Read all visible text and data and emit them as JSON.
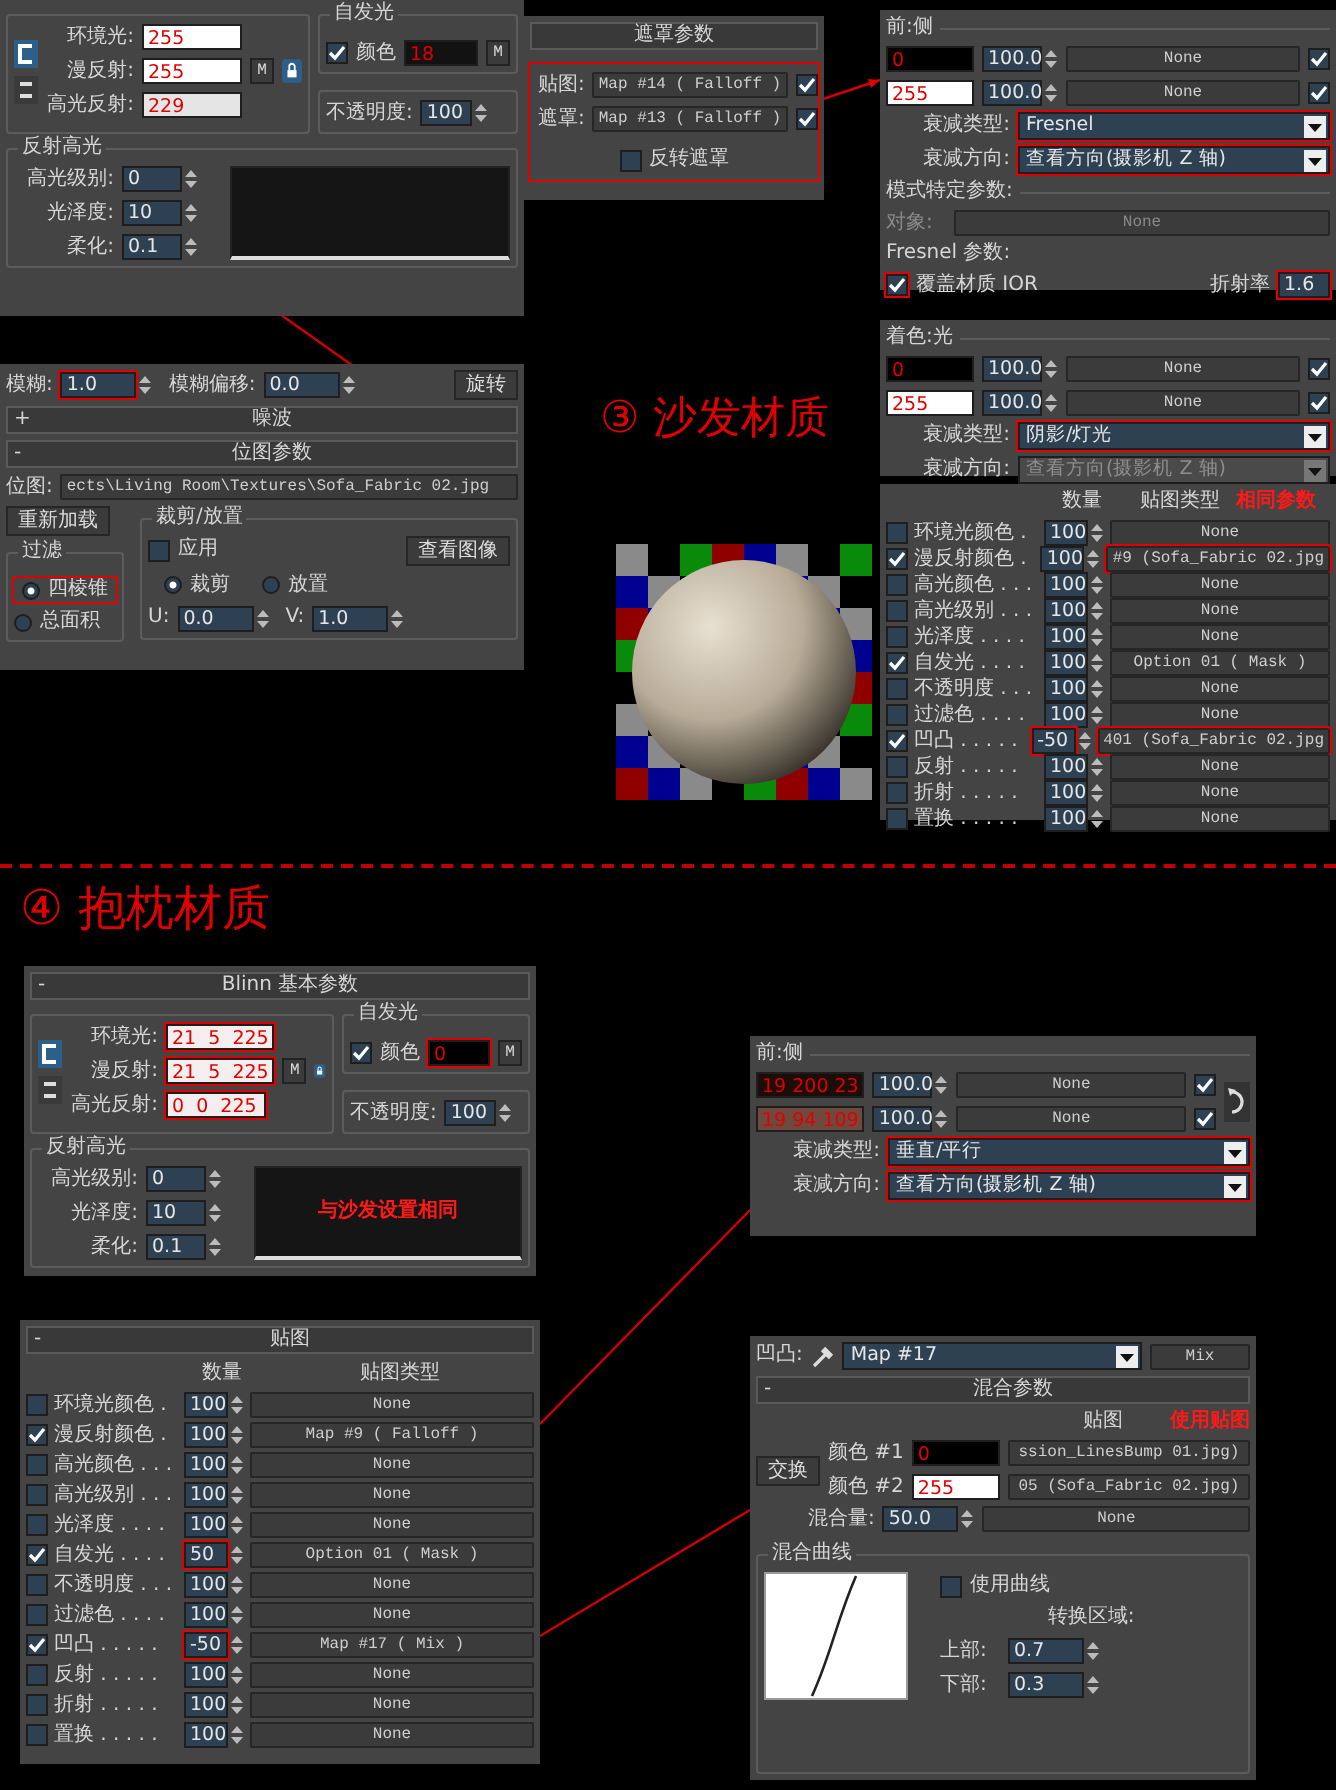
{
  "panels": [
    {
      "kind": "blinn",
      "colors": [
        {
          "label": "环境光:",
          "value": "255",
          "color": "#ffffff"
        },
        {
          "label": "漫反射:",
          "value": "255",
          "color": "#ffffff",
          "map_button": "M"
        },
        {
          "label": "高光反射:",
          "value": "229",
          "color": "#e5e5e5"
        }
      ],
      "self_illum": {
        "title": "自发光",
        "checked": true,
        "label": "颜色",
        "value": "18",
        "color": "#121212",
        "map_button": "M"
      },
      "opacity": {
        "label": "不透明度:",
        "value": "100"
      },
      "specular": {
        "title": "反射高光",
        "fields": [
          {
            "label": "高光级别:",
            "value": "0"
          },
          {
            "label": "光泽度:",
            "value": "10"
          },
          {
            "label": "柔化:",
            "value": "0.1"
          }
        ]
      }
    },
    {
      "kind": "mask",
      "title": {
        "text": "遮罩参数"
      },
      "highlighted": true,
      "rows": [
        {
          "label": "贴图:",
          "map": "Map #14  ( Falloff )",
          "checked": true
        },
        {
          "label": "遮罩:",
          "map": "Map #13  ( Falloff )",
          "checked": true
        }
      ],
      "invert": {
        "label": "反转遮罩",
        "checked": false
      }
    },
    {
      "kind": "falloff",
      "title": "前:侧",
      "colors": [
        {
          "value": "0",
          "color": "#000000",
          "amount": "100.0",
          "map": "None",
          "checked": true
        },
        {
          "value": "255",
          "color": "#ffffff",
          "amount": "100.0",
          "map": "None",
          "checked": true
        }
      ],
      "falloff_type": {
        "label": "衰减类型:",
        "value": "Fresnel",
        "highlighted": true,
        "disabled": false
      },
      "direction": {
        "label": "衰减方向:",
        "value": "查看方向(摄影机 Z 轴)",
        "highlighted": true,
        "disabled": false
      },
      "mode": {
        "title": "模式特定参数:",
        "object_label": "对象:",
        "object_value": "None",
        "fresnel_title": "Fresnel 参数:",
        "override": {
          "label": "覆盖材质 IOR",
          "checked": true,
          "highlighted": true
        },
        "ior": {
          "label": "折射率",
          "value": "1.6",
          "highlighted": true
        }
      }
    },
    {
      "kind": "bitmap",
      "blur": {
        "label": "模糊:",
        "value": "1.0",
        "highlighted": true
      },
      "blur_offset": {
        "label": "模糊偏移:",
        "value": "0.0"
      },
      "rotate_button": "旋转",
      "rollouts": [
        {
          "sign": "+",
          "text": "噪波"
        },
        {
          "sign": "-",
          "text": "位图参数"
        }
      ],
      "bitmap": {
        "label": "位图:",
        "path": "ects\\Living Room\\Textures\\Sofa_Fabric 02.jpg"
      },
      "reload_button": "重新加载",
      "filter": {
        "title": "过滤",
        "options": [
          {
            "label": "四棱锥",
            "selected": true,
            "highlighted": true
          },
          {
            "label": "总面积",
            "selected": false
          }
        ]
      },
      "crop": {
        "title": "裁剪/放置",
        "apply": {
          "label": "应用",
          "checked": false
        },
        "view_button": "查看图像",
        "options": [
          {
            "label": "裁剪",
            "selected": true
          },
          {
            "label": "放置",
            "selected": false
          }
        ],
        "u": {
          "label": "U:",
          "value": "0.0"
        },
        "v": {
          "label": "V:",
          "value": "1.0"
        }
      }
    },
    {
      "kind": "falloff",
      "title": "着色:光",
      "colors": [
        {
          "value": "0",
          "color": "#000000",
          "amount": "100.0",
          "map": "None",
          "checked": true
        },
        {
          "value": "255",
          "color": "#ffffff",
          "amount": "100.0",
          "map": "None",
          "checked": true
        }
      ],
      "falloff_type": {
        "label": "衰减类型:",
        "value": "阴影/灯光",
        "highlighted": true,
        "disabled": false
      },
      "direction": {
        "label": "衰减方向:",
        "value": "查看方向(摄影机 Z 轴)",
        "highlighted": false,
        "disabled": true
      }
    },
    {
      "kind": "maps",
      "columns": [
        "数量",
        "贴图类型"
      ],
      "note": "相同参数",
      "rows": [
        {
          "label": "环境光颜色 .",
          "checked": false,
          "amount": "100",
          "map": "None"
        },
        {
          "label": "漫反射颜色 .",
          "checked": true,
          "amount": "100",
          "map": "#9 (Sofa_Fabric 02.jpg",
          "map_highlighted": true
        },
        {
          "label": "高光颜色 . . .",
          "checked": false,
          "amount": "100",
          "map": "None"
        },
        {
          "label": "高光级别 . . .",
          "checked": false,
          "amount": "100",
          "map": "None"
        },
        {
          "label": "光泽度 . . . .",
          "checked": false,
          "amount": "100",
          "map": "None"
        },
        {
          "label": "自发光 . . . .",
          "checked": true,
          "amount": "100",
          "map": "Option 01  ( Mask )"
        },
        {
          "label": "不透明度 . . .",
          "checked": false,
          "amount": "100",
          "map": "None"
        },
        {
          "label": "过滤色 . . . .",
          "checked": false,
          "amount": "100",
          "map": "None"
        },
        {
          "label": "凹凸 . . . . .",
          "checked": true,
          "amount": "-50",
          "amount_highlighted": true,
          "map": "401 (Sofa_Fabric 02.jpg",
          "map_highlighted": true
        },
        {
          "label": "反射 . . . . .",
          "checked": false,
          "amount": "100",
          "map": "None"
        },
        {
          "label": "折射 . . . . .",
          "checked": false,
          "amount": "100",
          "map": "None"
        },
        {
          "label": "置换 . . . . .",
          "checked": false,
          "amount": "100",
          "map": "None"
        }
      ]
    },
    {
      "kind": "blinn",
      "title": {
        "sign": "-",
        "text": "Blinn 基本参数"
      },
      "note": "与沙发设置相同",
      "colors": [
        {
          "label": "环境光:",
          "value": "21  5  225",
          "color": "#f4eeee",
          "highlighted": true
        },
        {
          "label": "漫反射:",
          "value": "21  5  225",
          "color": "#f4eeee",
          "map_button": "M",
          "highlighted": true
        },
        {
          "label": "高光反射:",
          "value": "0  0  225",
          "color": "#f4eeee",
          "highlighted": true
        }
      ],
      "self_illum": {
        "title": "自发光",
        "checked": true,
        "label": "颜色",
        "value": "0",
        "color": "#000000",
        "map_button": "M",
        "highlighted": true
      },
      "opacity": {
        "label": "不透明度:",
        "value": "100"
      },
      "specular": {
        "title": "反射高光",
        "fields": [
          {
            "label": "高光级别:",
            "value": "0"
          },
          {
            "label": "光泽度:",
            "value": "10"
          },
          {
            "label": "柔化:",
            "value": "0.1"
          }
        ]
      }
    },
    {
      "kind": "falloff",
      "title": "前:侧",
      "swap_button": true,
      "colors": [
        {
          "value": "19 200 23",
          "color": "#1c0d08",
          "amount": "100.0",
          "map": "None",
          "checked": true
        },
        {
          "value": "19 94 109",
          "color": "#6e4a3e",
          "amount": "100.0",
          "map": "None",
          "checked": true
        }
      ],
      "falloff_type": {
        "label": "衰减类型:",
        "value": "垂直/平行",
        "highlighted": true,
        "disabled": false
      },
      "direction": {
        "label": "衰减方向:",
        "value": "查看方向(摄影机 Z 轴)",
        "highlighted": true,
        "disabled": false
      }
    },
    {
      "kind": "maps",
      "title": {
        "sign": "-",
        "text": "贴图"
      },
      "columns": [
        "数量",
        "贴图类型"
      ],
      "rows": [
        {
          "label": "环境光颜色 .",
          "checked": false,
          "amount": "100",
          "map": "None"
        },
        {
          "label": "漫反射颜色 .",
          "checked": true,
          "amount": "100",
          "map": "Map #9  ( Falloff )"
        },
        {
          "label": "高光颜色 . . .",
          "checked": false,
          "amount": "100",
          "map": "None"
        },
        {
          "label": "高光级别 . . .",
          "checked": false,
          "amount": "100",
          "map": "None"
        },
        {
          "label": "光泽度 . . . .",
          "checked": false,
          "amount": "100",
          "map": "None"
        },
        {
          "label": "自发光 . . . .",
          "checked": true,
          "amount": "50",
          "amount_highlighted": true,
          "map": "Option 01  ( Mask )"
        },
        {
          "label": "不透明度 . . .",
          "checked": false,
          "amount": "100",
          "map": "None"
        },
        {
          "label": "过滤色 . . . .",
          "checked": false,
          "amount": "100",
          "map": "None"
        },
        {
          "label": "凹凸 . . . . .",
          "checked": true,
          "amount": "-50",
          "amount_highlighted": true,
          "map": "Map #17  ( Mix )"
        },
        {
          "label": "反射 . . . . .",
          "checked": false,
          "amount": "100",
          "map": "None"
        },
        {
          "label": "折射 . . . . .",
          "checked": false,
          "amount": "100",
          "map": "None"
        },
        {
          "label": "置换 . . . . .",
          "checked": false,
          "amount": "100",
          "map": "None"
        }
      ]
    },
    {
      "kind": "mix",
      "bump": {
        "label": "凹凸:",
        "map": "Map #17",
        "type": "Mix"
      },
      "title": {
        "sign": "-",
        "text": "混合参数"
      },
      "map_header": "贴图",
      "swap_button": "交换",
      "note": "使用贴图",
      "colors": [
        {
          "label": "颜色 #1",
          "value": "0",
          "color": "#000000",
          "map": "ssion_LinesBump 01.jpg)"
        },
        {
          "label": "颜色 #2",
          "value": "255",
          "color": "#ffffff",
          "map": "05 (Sofa_Fabric 02.jpg)"
        }
      ],
      "amount": {
        "label": "混合量:",
        "value": "50.0",
        "map": "None"
      },
      "curve": {
        "title": "混合曲线",
        "use_curve": {
          "label": "使用曲线",
          "checked": false
        },
        "zone_title": "转换区域:",
        "upper": {
          "label": "上部:",
          "value": "0.7"
        },
        "lower": {
          "label": "下部:",
          "value": "0.3"
        }
      }
    }
  ],
  "headings": [
    {
      "text": "③ 沙发材质"
    },
    {
      "text": "④ 抱枕材质"
    }
  ]
}
